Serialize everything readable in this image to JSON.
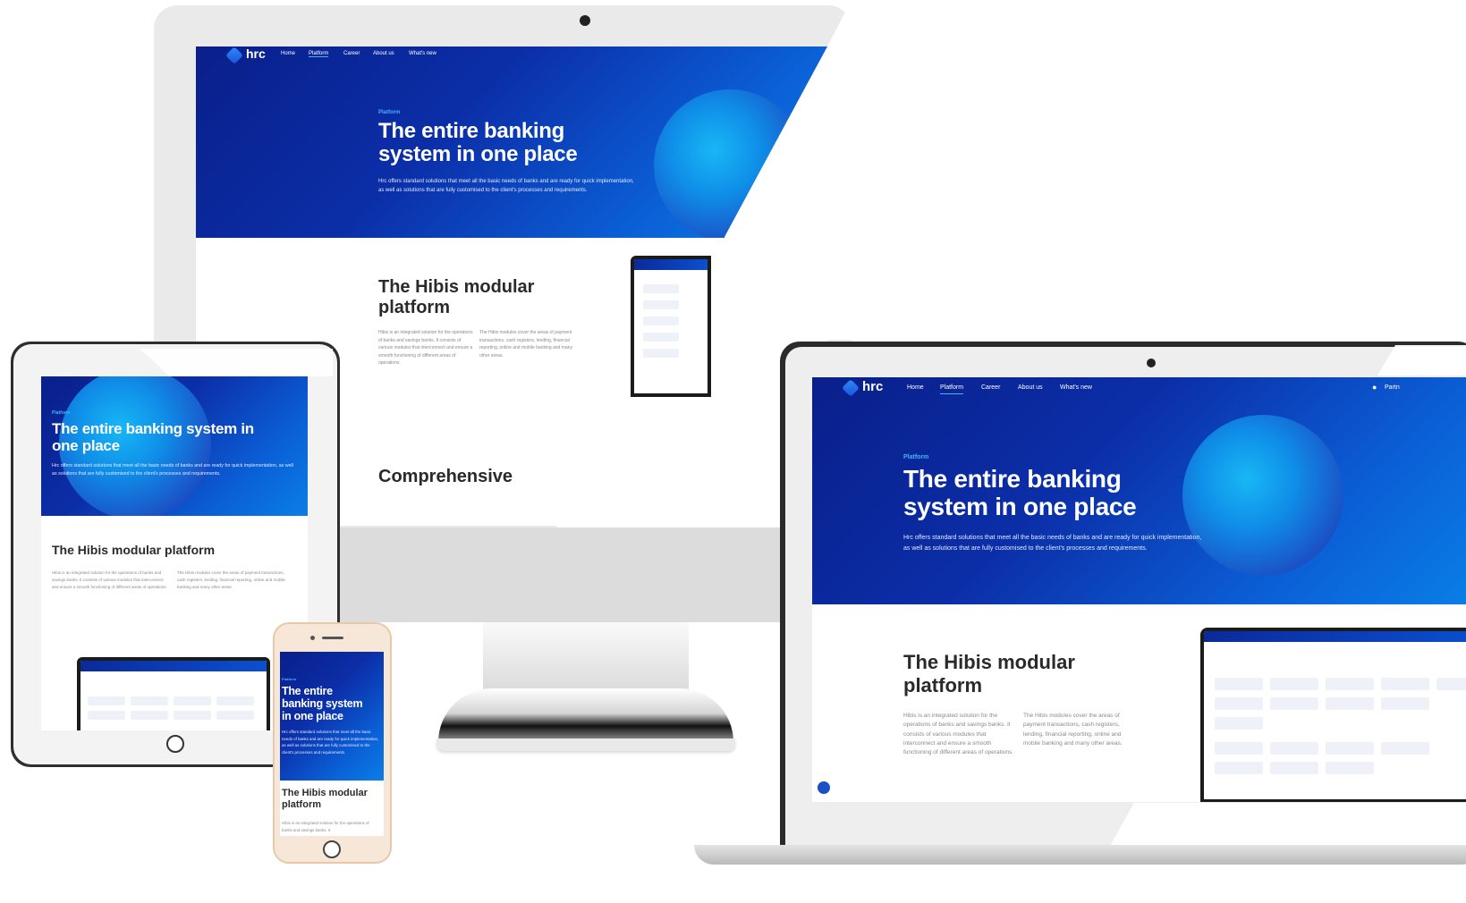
{
  "site": {
    "logo": "hrc",
    "nav": [
      "Home",
      "Platform",
      "Career",
      "About us",
      "What's new"
    ],
    "partner_label": "Partn",
    "hero": {
      "kicker": "Platform",
      "title_line1": "The entire banking",
      "title_line2": "system in one place",
      "tablet_title_line1": "The entire banking system in",
      "tablet_title_line2": "one place",
      "phone_title_line1": "The entire",
      "phone_title_line2": "banking system",
      "phone_title_line3": "in one place",
      "description": "Hrc offers standard solutions that meet all the basic needs of banks and are ready for quick implementation, as well as solutions that are fully customised to the client's processes and requirements."
    },
    "section": {
      "title_line1": "The Hibis modular",
      "title_line2": "platform",
      "tablet_title": "The Hibis modular platform",
      "col1": "Hibis is an integrated solution for the operations of banks and savings banks. It consists of various modules that interconnect and ensure a smooth functioning of different areas of operations.",
      "col2": "The Hibis modules cover the areas of payment transactions, cash registers, lending, financial reporting, online and mobile banking and many other areas.",
      "phone_text": "Hibis is an integrated solution for the operations of banks and savings banks. It"
    },
    "next_section_title": "Comprehensive"
  },
  "colors": {
    "hero_dark": "#0a1f8a",
    "hero_light": "#0a7fe6",
    "accent": "#41b3ff"
  }
}
